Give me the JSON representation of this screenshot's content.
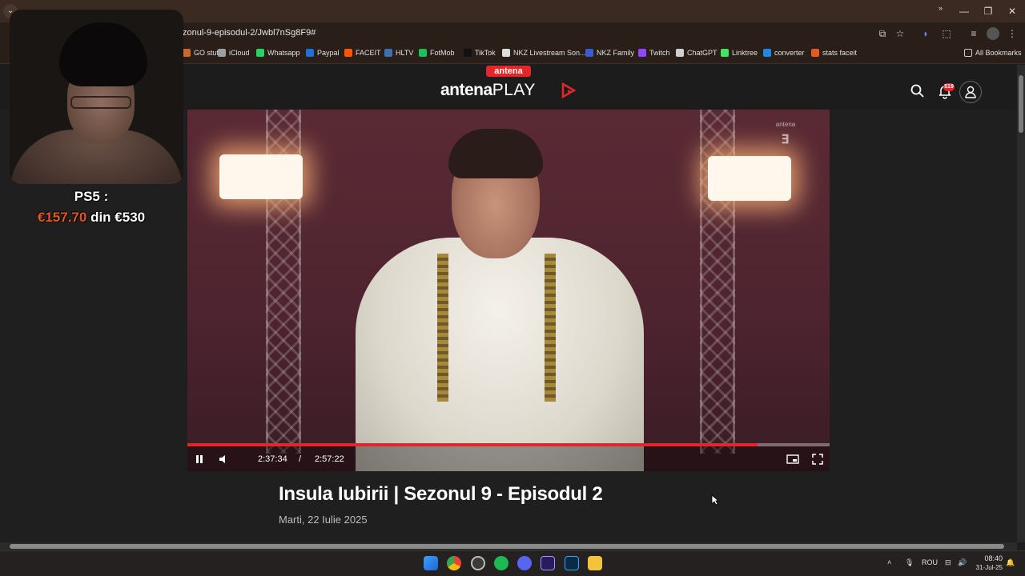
{
  "browser": {
    "url": "zonul-9-episodul-2/Jwbl7nSg8F9#",
    "bookmarks": [
      {
        "label": "GO stuff",
        "color": "#c56b2a"
      },
      {
        "label": "iCloud",
        "color": "#9aa0a6"
      },
      {
        "label": "Whatsapp",
        "color": "#25d366"
      },
      {
        "label": "Paypal",
        "color": "#1f6fd8"
      },
      {
        "label": "FACEIT",
        "color": "#ff5500"
      },
      {
        "label": "HLTV",
        "color": "#3d6fb3"
      },
      {
        "label": "FotMob",
        "color": "#16c25a"
      },
      {
        "label": "TikTok",
        "color": "#111111"
      },
      {
        "label": "NKZ Livestream Son...",
        "color": "#dddddd"
      },
      {
        "label": "NKZ Family",
        "color": "#3a5bd8"
      },
      {
        "label": "Twitch",
        "color": "#9146ff"
      },
      {
        "label": "ChatGPT",
        "color": "#cfcfcf"
      },
      {
        "label": "Linktree",
        "color": "#43e55e"
      },
      {
        "label": "converter",
        "color": "#1e88e5"
      },
      {
        "label": "stats faceit",
        "color": "#e8571c"
      }
    ],
    "more_bookmarks": "»",
    "all_bookmarks": "All Bookmarks"
  },
  "site": {
    "badge": "antena",
    "logo_main": "antena",
    "logo_play": "PLAY",
    "notification_count": "519",
    "accent": "#e3262a"
  },
  "player": {
    "current_time": "2:37:34",
    "separator": "/",
    "duration": "2:57:22",
    "progress_fraction": 0.888,
    "channel_logo": "antena"
  },
  "video": {
    "title": "Insula Iubirii | Sezonul 9 - Episodul 2",
    "date": "Marti, 22 Iulie 2025"
  },
  "overlay": {
    "label": "PS5 :",
    "current": "€157.70",
    "joiner": "din",
    "target": "€530"
  },
  "taskbar": {
    "language": "ROU",
    "time": "08:40",
    "date": "31-Jul-25"
  }
}
